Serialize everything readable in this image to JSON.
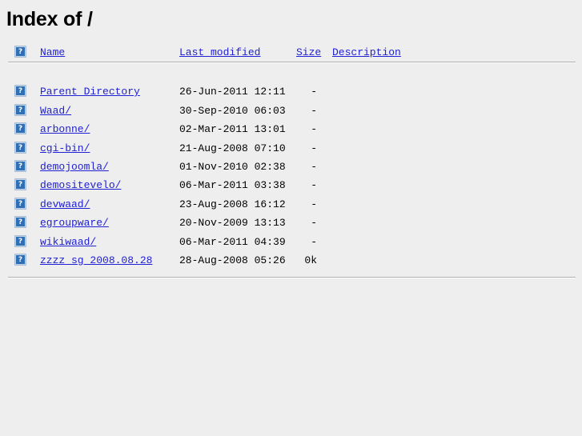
{
  "page": {
    "title": "Index of /",
    "title_path": "/",
    "background_color": "#eeeeee",
    "link_color": "#2121d4",
    "text_color": "#000000",
    "rule_color": "#b0b0b0"
  },
  "columns": {
    "icon_header_alt": "[ICO]",
    "name": "Name",
    "last_modified": "Last modified",
    "size": "Size",
    "description": "Description"
  },
  "entries": [
    {
      "icon": "broken-image-icon",
      "name": "Parent Directory",
      "last_modified": "26-Jun-2011 12:11",
      "size": "-",
      "description": ""
    },
    {
      "icon": "broken-image-icon",
      "name": "Waad/",
      "last_modified": "30-Sep-2010 06:03",
      "size": "-",
      "description": ""
    },
    {
      "icon": "broken-image-icon",
      "name": "arbonne/",
      "last_modified": "02-Mar-2011 13:01",
      "size": "-",
      "description": ""
    },
    {
      "icon": "broken-image-icon",
      "name": "cgi-bin/",
      "last_modified": "21-Aug-2008 07:10",
      "size": "-",
      "description": ""
    },
    {
      "icon": "broken-image-icon",
      "name": "demojoomla/",
      "last_modified": "01-Nov-2010 02:38",
      "size": "-",
      "description": ""
    },
    {
      "icon": "broken-image-icon",
      "name": "demositevelo/",
      "last_modified": "06-Mar-2011 03:38",
      "size": "-",
      "description": ""
    },
    {
      "icon": "broken-image-icon",
      "name": "devwaad/",
      "last_modified": "23-Aug-2008 16:12",
      "size": "-",
      "description": ""
    },
    {
      "icon": "broken-image-icon",
      "name": "egroupware/",
      "last_modified": "20-Nov-2009 13:13",
      "size": "-",
      "description": ""
    },
    {
      "icon": "broken-image-icon",
      "name": "wikiwaad/",
      "last_modified": "06-Mar-2011 04:39",
      "size": "-",
      "description": ""
    },
    {
      "icon": "broken-image-icon",
      "name": "zzzz_sg_2008.08.28",
      "last_modified": "28-Aug-2008 05:26",
      "size": "0k",
      "description": ""
    }
  ]
}
